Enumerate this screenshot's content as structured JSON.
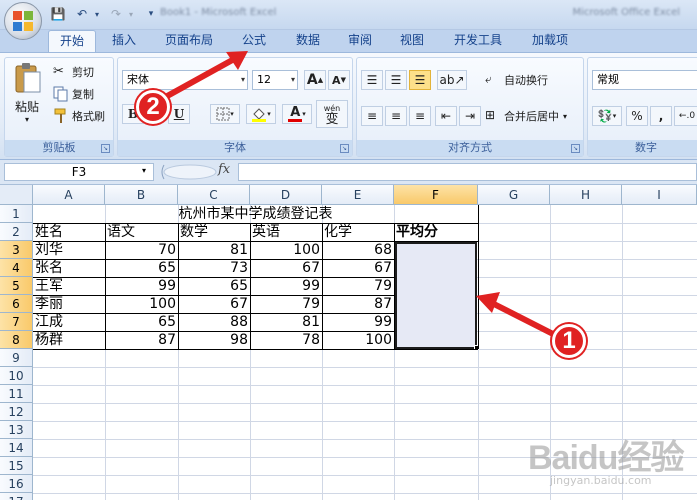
{
  "app": {
    "title_left": "Book1 - Microsoft Excel",
    "title_right": "Microsoft Office Excel",
    "quick_access": {
      "save": "💾",
      "undo": "↶",
      "redo": "↷",
      "dropdown": "▾",
      "customize": "▾"
    }
  },
  "tabs": [
    {
      "label": "开始",
      "active": true
    },
    {
      "label": "插入"
    },
    {
      "label": "页面布局"
    },
    {
      "label": "公式"
    },
    {
      "label": "数据"
    },
    {
      "label": "审阅"
    },
    {
      "label": "视图"
    },
    {
      "label": "开发工具"
    },
    {
      "label": "加载项"
    }
  ],
  "ribbon": {
    "clipboard": {
      "label": "剪贴板",
      "paste": "粘贴",
      "cut": "剪切",
      "copy": "复制",
      "format_painter": "格式刷"
    },
    "font": {
      "label": "字体",
      "font_name": "宋体",
      "font_size": "12",
      "grow": "A",
      "shrink": "A",
      "bold": "B",
      "underline": "U",
      "font_color_letter": "A",
      "phonetic_top": "wén",
      "phonetic": "变"
    },
    "alignment": {
      "label": "对齐方式",
      "wrap_text": "自动换行",
      "merge_center": "合并后居中"
    },
    "number": {
      "label": "数字",
      "format": "常规",
      "percent": "%",
      "comma": ",",
      "decimal": "←.0"
    }
  },
  "formula_bar": {
    "cell_ref": "F3",
    "fx": "fx",
    "content": ""
  },
  "sheet": {
    "columns": [
      "A",
      "B",
      "C",
      "D",
      "E",
      "F",
      "G",
      "H",
      "I"
    ],
    "selected_column": "F",
    "rows": [
      "1",
      "2",
      "3",
      "4",
      "5",
      "6",
      "7",
      "8",
      "9",
      "10",
      "11",
      "12",
      "13",
      "14",
      "15",
      "16",
      "17"
    ],
    "selected_rows": [
      "3",
      "4",
      "5",
      "6",
      "7",
      "8"
    ],
    "title": "杭州市某中学成绩登记表",
    "headers": [
      "姓名",
      "语文",
      "数学",
      "英语",
      "化学",
      "平均分"
    ],
    "records": [
      {
        "name": "刘华",
        "chinese": "70",
        "math": "81",
        "english": "100",
        "chemistry": "68"
      },
      {
        "name": "张名",
        "chinese": "65",
        "math": "73",
        "english": "67",
        "chemistry": "67"
      },
      {
        "name": "王军",
        "chinese": "99",
        "math": "65",
        "english": "99",
        "chemistry": "79"
      },
      {
        "name": "李丽",
        "chinese": "100",
        "math": "67",
        "english": "79",
        "chemistry": "87"
      },
      {
        "name": "江成",
        "chinese": "65",
        "math": "88",
        "english": "81",
        "chemistry": "99"
      },
      {
        "name": "杨群",
        "chinese": "87",
        "math": "98",
        "english": "78",
        "chemistry": "100"
      }
    ]
  },
  "annotations": {
    "marker_1": "1",
    "marker_2": "2",
    "accent": "#e02222"
  },
  "watermark": {
    "brand": "Baidu经验",
    "sub": "jingyan.baidu.com"
  }
}
